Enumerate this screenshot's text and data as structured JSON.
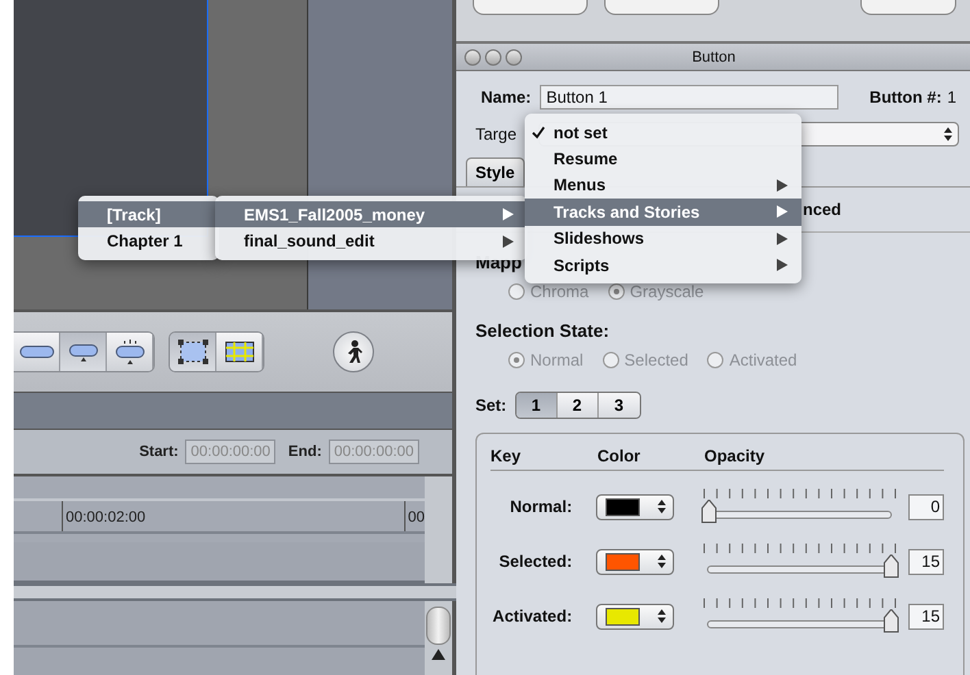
{
  "workspace": {
    "toolbar": [
      {
        "kind": "pill",
        "selected": false
      },
      {
        "kind": "pill-low",
        "selected": true
      },
      {
        "kind": "pill-glow",
        "selected": false
      },
      {
        "kind": "select-box",
        "selected": true
      },
      {
        "kind": "grid",
        "selected": false
      },
      {
        "kind": "figure"
      }
    ],
    "timeline": {
      "start_label": "Start:",
      "start_value": "00:00:00:00",
      "end_label": "End:",
      "end_value": "00:00:00:00",
      "ruler_labels": [
        "00:00:02:00",
        "00"
      ]
    }
  },
  "inspector": {
    "title": "Button",
    "name_label": "Name:",
    "name_value": "Button 1",
    "number_label": "Button #:",
    "number_value": "1",
    "target_label": "Targe",
    "tabs": [
      {
        "label": "Style",
        "selected": true
      }
    ],
    "advanced_label": "nced",
    "mapping_label": "Mapp",
    "mapping_options": [
      {
        "label": "Chroma",
        "selected": false,
        "disabled": true
      },
      {
        "label": "Grayscale",
        "selected": true,
        "disabled": true
      }
    ],
    "selection_state_label": "Selection State:",
    "selection_states": [
      {
        "label": "Normal",
        "selected": true,
        "disabled": true
      },
      {
        "label": "Selected",
        "selected": false,
        "disabled": true
      },
      {
        "label": "Activated",
        "selected": false,
        "disabled": true
      }
    ],
    "set_label": "Set:",
    "sets": [
      {
        "label": "1",
        "selected": true
      },
      {
        "label": "2",
        "selected": false
      },
      {
        "label": "3",
        "selected": false
      }
    ],
    "color_table": {
      "columns": [
        "Key",
        "Color",
        "Opacity"
      ],
      "rows": [
        {
          "key": "Normal:",
          "color": "#000000",
          "level": 0,
          "value": "0"
        },
        {
          "key": "Selected:",
          "color": "#ff5500",
          "level": 1,
          "value": "15"
        },
        {
          "key": "Activated:",
          "color": "#e8e800",
          "level": 1,
          "value": "15"
        }
      ]
    }
  },
  "menus": [
    {
      "items": [
        {
          "label": "[Track]",
          "checked": false,
          "submenu": false,
          "selected": true
        },
        {
          "label": "Chapter 1",
          "checked": false,
          "submenu": false,
          "selected": false
        }
      ]
    },
    {
      "items": [
        {
          "label": "EMS1_Fall2005_money",
          "checked": false,
          "submenu": true,
          "selected": true
        },
        {
          "label": "final_sound_edit",
          "checked": false,
          "submenu": true,
          "selected": false
        }
      ]
    },
    {
      "items": [
        {
          "label": "not set",
          "checked": true,
          "submenu": false,
          "selected": false
        },
        {
          "label": "Resume",
          "checked": false,
          "submenu": false,
          "selected": false
        },
        {
          "label": "Menus",
          "checked": false,
          "submenu": true,
          "selected": false
        },
        {
          "label": "Tracks and Stories",
          "checked": false,
          "submenu": true,
          "selected": true
        },
        {
          "label": "Slideshows",
          "checked": false,
          "submenu": true,
          "selected": false
        },
        {
          "label": "Scripts",
          "checked": false,
          "submenu": true,
          "selected": false
        }
      ]
    }
  ]
}
